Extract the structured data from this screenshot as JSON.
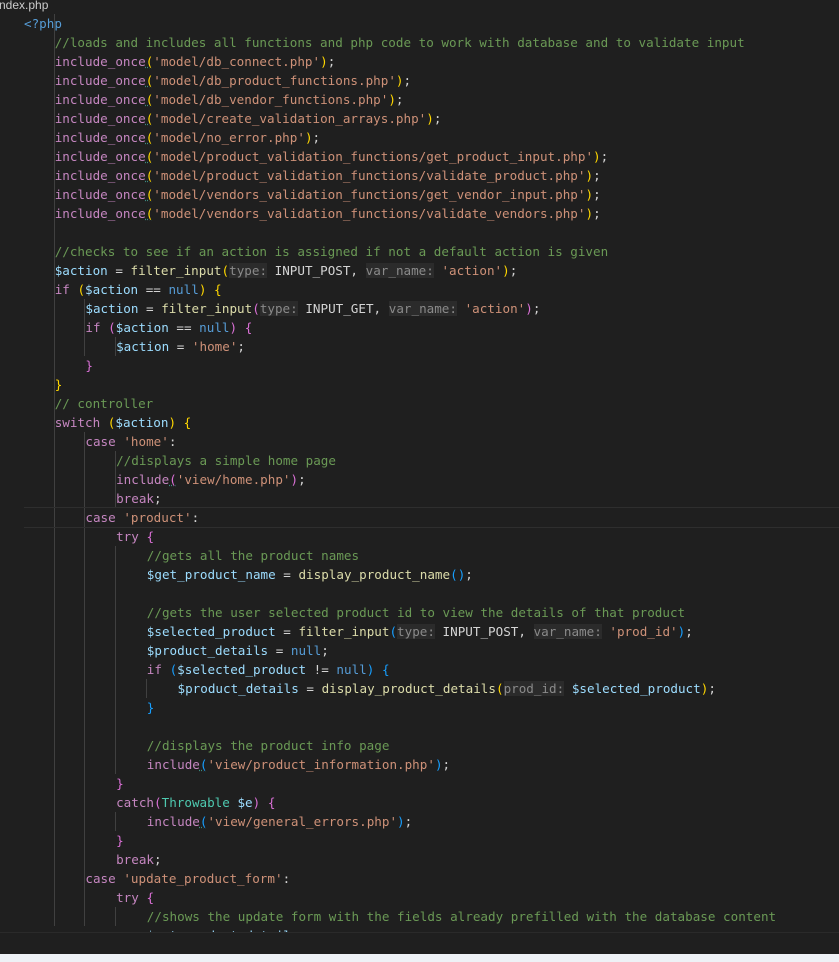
{
  "tab": {
    "filename": "ndex.php"
  },
  "code_lines": [
    {
      "indent": 1,
      "tokens": [
        [
          "tag",
          "<?php"
        ]
      ]
    },
    {
      "indent": 2,
      "tokens": [
        [
          "cm",
          "//loads and includes all functions and php code to work with database and to validate input"
        ]
      ]
    },
    {
      "indent": 2,
      "tokens": [
        [
          "kw",
          "include_once"
        ],
        [
          "br1sq",
          "("
        ],
        [
          "str",
          "'model/db_connect.php'"
        ],
        [
          "br1",
          ")"
        ],
        [
          "pl",
          ";"
        ]
      ]
    },
    {
      "indent": 2,
      "tokens": [
        [
          "kw",
          "include_once"
        ],
        [
          "br1sq",
          "("
        ],
        [
          "str",
          "'model/db_product_functions.php'"
        ],
        [
          "br1",
          ")"
        ],
        [
          "pl",
          ";"
        ]
      ]
    },
    {
      "indent": 2,
      "tokens": [
        [
          "kw",
          "include_once"
        ],
        [
          "br1sq",
          "("
        ],
        [
          "str",
          "'model/db_vendor_functions.php'"
        ],
        [
          "br1",
          ")"
        ],
        [
          "pl",
          ";"
        ]
      ]
    },
    {
      "indent": 2,
      "tokens": [
        [
          "kw",
          "include_once"
        ],
        [
          "br1sq",
          "("
        ],
        [
          "str",
          "'model/create_validation_arrays.php'"
        ],
        [
          "br1",
          ")"
        ],
        [
          "pl",
          ";"
        ]
      ]
    },
    {
      "indent": 2,
      "tokens": [
        [
          "kw",
          "include_once"
        ],
        [
          "br1sq",
          "("
        ],
        [
          "str",
          "'model/no_error.php'"
        ],
        [
          "br1",
          ")"
        ],
        [
          "pl",
          ";"
        ]
      ]
    },
    {
      "indent": 2,
      "tokens": [
        [
          "kw",
          "include_once"
        ],
        [
          "br1sq",
          "("
        ],
        [
          "str",
          "'model/product_validation_functions/get_product_input.php'"
        ],
        [
          "br1",
          ")"
        ],
        [
          "pl",
          ";"
        ]
      ]
    },
    {
      "indent": 2,
      "tokens": [
        [
          "kw",
          "include_once"
        ],
        [
          "br1sq",
          "("
        ],
        [
          "str",
          "'model/product_validation_functions/validate_product.php'"
        ],
        [
          "br1",
          ")"
        ],
        [
          "pl",
          ";"
        ]
      ]
    },
    {
      "indent": 2,
      "tokens": [
        [
          "kw",
          "include_once"
        ],
        [
          "br1sq",
          "("
        ],
        [
          "str",
          "'model/vendors_validation_functions/get_vendor_input.php'"
        ],
        [
          "br1",
          ")"
        ],
        [
          "pl",
          ";"
        ]
      ]
    },
    {
      "indent": 2,
      "tokens": [
        [
          "kw",
          "include_once"
        ],
        [
          "br1sq",
          "("
        ],
        [
          "str",
          "'model/vendors_validation_functions/validate_vendors.php'"
        ],
        [
          "br1",
          ")"
        ],
        [
          "pl",
          ";"
        ]
      ]
    },
    {
      "indent": 2,
      "tokens": []
    },
    {
      "indent": 2,
      "tokens": [
        [
          "cm",
          "//checks to see if an action is assigned if not a default action is given"
        ]
      ]
    },
    {
      "indent": 2,
      "tokens": [
        [
          "var",
          "$action"
        ],
        [
          "pl",
          " = "
        ],
        [
          "fn",
          "filter_input"
        ],
        [
          "br1",
          "("
        ],
        [
          "hint",
          "type:"
        ],
        [
          "pl",
          " INPUT_POST, "
        ],
        [
          "hint",
          "var_name:"
        ],
        [
          "pl",
          " "
        ],
        [
          "str",
          "'action'"
        ],
        [
          "br1",
          ")"
        ],
        [
          "pl",
          ";"
        ]
      ]
    },
    {
      "indent": 2,
      "tokens": [
        [
          "kw",
          "if"
        ],
        [
          "pl",
          " "
        ],
        [
          "br1",
          "("
        ],
        [
          "var",
          "$action"
        ],
        [
          "pl",
          " == "
        ],
        [
          "const",
          "null"
        ],
        [
          "br1",
          ")"
        ],
        [
          "pl",
          " "
        ],
        [
          "br1",
          "{"
        ]
      ]
    },
    {
      "indent": 3,
      "tokens": [
        [
          "var",
          "$action"
        ],
        [
          "pl",
          " = "
        ],
        [
          "fn",
          "filter_input"
        ],
        [
          "br2",
          "("
        ],
        [
          "hint",
          "type:"
        ],
        [
          "pl",
          " INPUT_GET, "
        ],
        [
          "hint",
          "var_name:"
        ],
        [
          "pl",
          " "
        ],
        [
          "str",
          "'action'"
        ],
        [
          "br2",
          ")"
        ],
        [
          "pl",
          ";"
        ]
      ]
    },
    {
      "indent": 3,
      "tokens": [
        [
          "kw",
          "if"
        ],
        [
          "pl",
          " "
        ],
        [
          "br2",
          "("
        ],
        [
          "var",
          "$action"
        ],
        [
          "pl",
          " == "
        ],
        [
          "const",
          "null"
        ],
        [
          "br2",
          ")"
        ],
        [
          "pl",
          " "
        ],
        [
          "br2",
          "{"
        ]
      ]
    },
    {
      "indent": 4,
      "tokens": [
        [
          "var",
          "$action"
        ],
        [
          "pl",
          " = "
        ],
        [
          "str",
          "'home'"
        ],
        [
          "pl",
          ";"
        ]
      ]
    },
    {
      "indent": 3,
      "tokens": [
        [
          "br2",
          "}"
        ]
      ]
    },
    {
      "indent": 2,
      "tokens": [
        [
          "br1",
          "}"
        ]
      ]
    },
    {
      "indent": 2,
      "tokens": [
        [
          "cm",
          "// controller"
        ]
      ]
    },
    {
      "indent": 2,
      "tokens": [
        [
          "kw",
          "switch"
        ],
        [
          "pl",
          " "
        ],
        [
          "br1",
          "("
        ],
        [
          "var",
          "$action"
        ],
        [
          "br1",
          ")"
        ],
        [
          "pl",
          " "
        ],
        [
          "br1",
          "{"
        ]
      ]
    },
    {
      "indent": 3,
      "tokens": [
        [
          "kw",
          "case"
        ],
        [
          "pl",
          " "
        ],
        [
          "str",
          "'home'"
        ],
        [
          "pl",
          ":"
        ]
      ]
    },
    {
      "indent": 4,
      "tokens": [
        [
          "cm",
          "//displays a simple home page"
        ]
      ]
    },
    {
      "indent": 4,
      "tokens": [
        [
          "kw",
          "include"
        ],
        [
          "br2sq",
          "("
        ],
        [
          "str",
          "'view/home.php'"
        ],
        [
          "br2",
          ")"
        ],
        [
          "pl",
          ";"
        ]
      ]
    },
    {
      "indent": 4,
      "tokens": [
        [
          "kw",
          "break"
        ],
        [
          "pl",
          ";"
        ]
      ]
    },
    {
      "indent": 3,
      "tokens": [
        [
          "kw",
          "case"
        ],
        [
          "pl",
          " "
        ],
        [
          "str",
          "'product'"
        ],
        [
          "pl",
          ":"
        ]
      ]
    },
    {
      "indent": 4,
      "tokens": [
        [
          "kw",
          "try"
        ],
        [
          "pl",
          " "
        ],
        [
          "br2",
          "{"
        ]
      ]
    },
    {
      "indent": 5,
      "tokens": [
        [
          "cm",
          "//gets all the product names"
        ]
      ]
    },
    {
      "indent": 5,
      "tokens": [
        [
          "var",
          "$get_product_name"
        ],
        [
          "pl",
          " = "
        ],
        [
          "fn",
          "display_product_name"
        ],
        [
          "br3",
          "()"
        ],
        [
          "pl",
          ";"
        ]
      ]
    },
    {
      "indent": 5,
      "tokens": []
    },
    {
      "indent": 5,
      "tokens": [
        [
          "cm",
          "//gets the user selected product id to view the details of that product"
        ]
      ]
    },
    {
      "indent": 5,
      "tokens": [
        [
          "var",
          "$selected_product"
        ],
        [
          "pl",
          " = "
        ],
        [
          "fn",
          "filter_input"
        ],
        [
          "br3",
          "("
        ],
        [
          "hint",
          "type:"
        ],
        [
          "pl",
          " INPUT_POST, "
        ],
        [
          "hint",
          "var_name:"
        ],
        [
          "pl",
          " "
        ],
        [
          "str",
          "'prod_id'"
        ],
        [
          "br3",
          ")"
        ],
        [
          "pl",
          ";"
        ]
      ]
    },
    {
      "indent": 5,
      "tokens": [
        [
          "var",
          "$product_details"
        ],
        [
          "pl",
          " = "
        ],
        [
          "const",
          "null"
        ],
        [
          "pl",
          ";"
        ]
      ]
    },
    {
      "indent": 5,
      "tokens": [
        [
          "kw",
          "if"
        ],
        [
          "pl",
          " "
        ],
        [
          "br3",
          "("
        ],
        [
          "var",
          "$selected_product"
        ],
        [
          "pl",
          " != "
        ],
        [
          "const",
          "null"
        ],
        [
          "br3",
          ")"
        ],
        [
          "pl",
          " "
        ],
        [
          "br3",
          "{"
        ]
      ]
    },
    {
      "indent": 6,
      "tokens": [
        [
          "var",
          "$product_details"
        ],
        [
          "pl",
          " = "
        ],
        [
          "fn",
          "display_product_details"
        ],
        [
          "br1",
          "("
        ],
        [
          "hint",
          "prod_id:"
        ],
        [
          "pl",
          " "
        ],
        [
          "var",
          "$selected_product"
        ],
        [
          "br1",
          ")"
        ],
        [
          "pl",
          ";"
        ]
      ]
    },
    {
      "indent": 5,
      "tokens": [
        [
          "br3",
          "}"
        ]
      ]
    },
    {
      "indent": 5,
      "tokens": []
    },
    {
      "indent": 5,
      "tokens": [
        [
          "cm",
          "//displays the product info page"
        ]
      ]
    },
    {
      "indent": 5,
      "tokens": [
        [
          "kw",
          "include"
        ],
        [
          "br3sq",
          "("
        ],
        [
          "str",
          "'view/product_information.php'"
        ],
        [
          "br3",
          ")"
        ],
        [
          "pl",
          ";"
        ]
      ]
    },
    {
      "indent": 4,
      "tokens": [
        [
          "br2",
          "}"
        ]
      ]
    },
    {
      "indent": 4,
      "tokens": [
        [
          "kw",
          "catch"
        ],
        [
          "br2",
          "("
        ],
        [
          "cls",
          "Throwable"
        ],
        [
          "pl",
          " "
        ],
        [
          "var",
          "$e"
        ],
        [
          "br2",
          ")"
        ],
        [
          "pl",
          " "
        ],
        [
          "br2",
          "{"
        ]
      ]
    },
    {
      "indent": 5,
      "tokens": [
        [
          "kw",
          "include"
        ],
        [
          "br3sq",
          "("
        ],
        [
          "str",
          "'view/general_errors.php'"
        ],
        [
          "br3",
          ")"
        ],
        [
          "pl",
          ";"
        ]
      ]
    },
    {
      "indent": 4,
      "tokens": [
        [
          "br2",
          "}"
        ]
      ]
    },
    {
      "indent": 4,
      "tokens": [
        [
          "kw",
          "break"
        ],
        [
          "pl",
          ";"
        ]
      ]
    },
    {
      "indent": 3,
      "tokens": [
        [
          "kw",
          "case"
        ],
        [
          "pl",
          " "
        ],
        [
          "str",
          "'update_product_form'"
        ],
        [
          "pl",
          ":"
        ]
      ]
    },
    {
      "indent": 4,
      "tokens": [
        [
          "kw",
          "try"
        ],
        [
          "pl",
          " "
        ],
        [
          "br2",
          "{"
        ]
      ]
    },
    {
      "indent": 5,
      "tokens": [
        [
          "cm",
          "//shows the update form with the fields already prefilled with the database content"
        ]
      ]
    },
    {
      "indent": 5,
      "tokens": [
        [
          "var",
          "$get_product_details"
        ],
        [
          "pl",
          " = ..."
        ]
      ]
    }
  ]
}
